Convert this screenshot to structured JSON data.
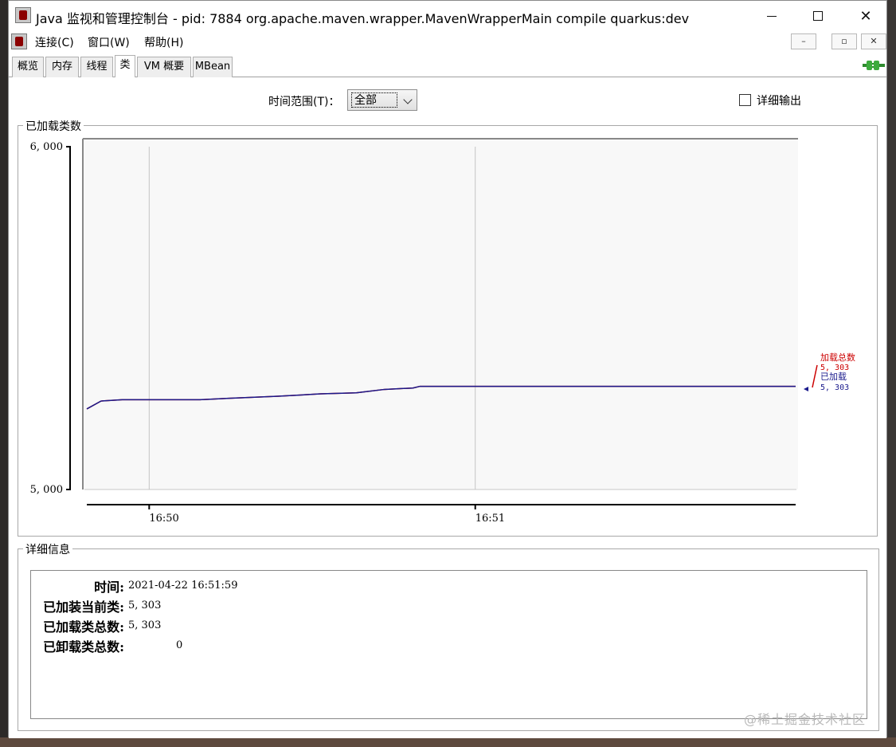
{
  "window": {
    "title": "Java 监视和管理控制台 - pid: 7884 org.apache.maven.wrapper.MavenWrapperMain compile quarkus:dev"
  },
  "menu": {
    "items": [
      "连接(C)",
      "窗口(W)",
      "帮助(H)"
    ]
  },
  "tabs": [
    "概览",
    "内存",
    "线程",
    "类",
    "VM 概要",
    "MBean"
  ],
  "active_tab": "类",
  "controls": {
    "time_range_label": "时间范围(T)：",
    "time_range_value": "全部",
    "verbose_label": "详细输出",
    "verbose_checked": false
  },
  "chart_section": {
    "title": "已加载类数"
  },
  "chart_data": {
    "type": "line",
    "y_ticks": [
      "6, 000",
      "5, 000"
    ],
    "ylim": [
      5000,
      6000
    ],
    "x_ticks": [
      "16:50",
      "16:51"
    ],
    "series": [
      {
        "name": "已加载",
        "color": "#1a1a8c",
        "values": [
          [
            0,
            5235
          ],
          [
            0.2,
            5258
          ],
          [
            0.5,
            5262
          ],
          [
            1.6,
            5262
          ],
          [
            2.0,
            5266
          ],
          [
            2.7,
            5272
          ],
          [
            3.3,
            5279
          ],
          [
            3.8,
            5282
          ],
          [
            4.2,
            5292
          ],
          [
            4.6,
            5296
          ],
          [
            4.7,
            5301
          ],
          [
            5.5,
            5301
          ],
          [
            10.0,
            5301
          ]
        ]
      },
      {
        "name": "加载总数",
        "color": "#cc0000",
        "values": [
          [
            0,
            5235
          ],
          [
            0.2,
            5258
          ],
          [
            0.5,
            5262
          ],
          [
            1.6,
            5262
          ],
          [
            2.0,
            5266
          ],
          [
            2.7,
            5272
          ],
          [
            3.3,
            5279
          ],
          [
            3.8,
            5282
          ],
          [
            4.2,
            5292
          ],
          [
            4.6,
            5296
          ],
          [
            4.7,
            5301
          ],
          [
            5.5,
            5301
          ],
          [
            10.0,
            5301
          ]
        ]
      }
    ],
    "legend": [
      {
        "name": "加载总数",
        "value": "5, 303",
        "color": "#cc0000"
      },
      {
        "name": "已加载",
        "value": "5, 303",
        "color": "#1a1a8c"
      }
    ],
    "x_range": [
      0,
      10
    ],
    "x_tick_positions": [
      0.88,
      5.48
    ]
  },
  "details_section": {
    "title": "详细信息",
    "rows": [
      {
        "label": "时间:",
        "value": "2021-04-22 16:51:59"
      },
      {
        "label": "已加装当前类:",
        "value": "5, 303"
      },
      {
        "label": "已加载类总数:",
        "value": "5, 303"
      },
      {
        "label": "已卸载类总数:",
        "value": "0"
      }
    ]
  },
  "watermark": "@稀土掘金技术社区"
}
